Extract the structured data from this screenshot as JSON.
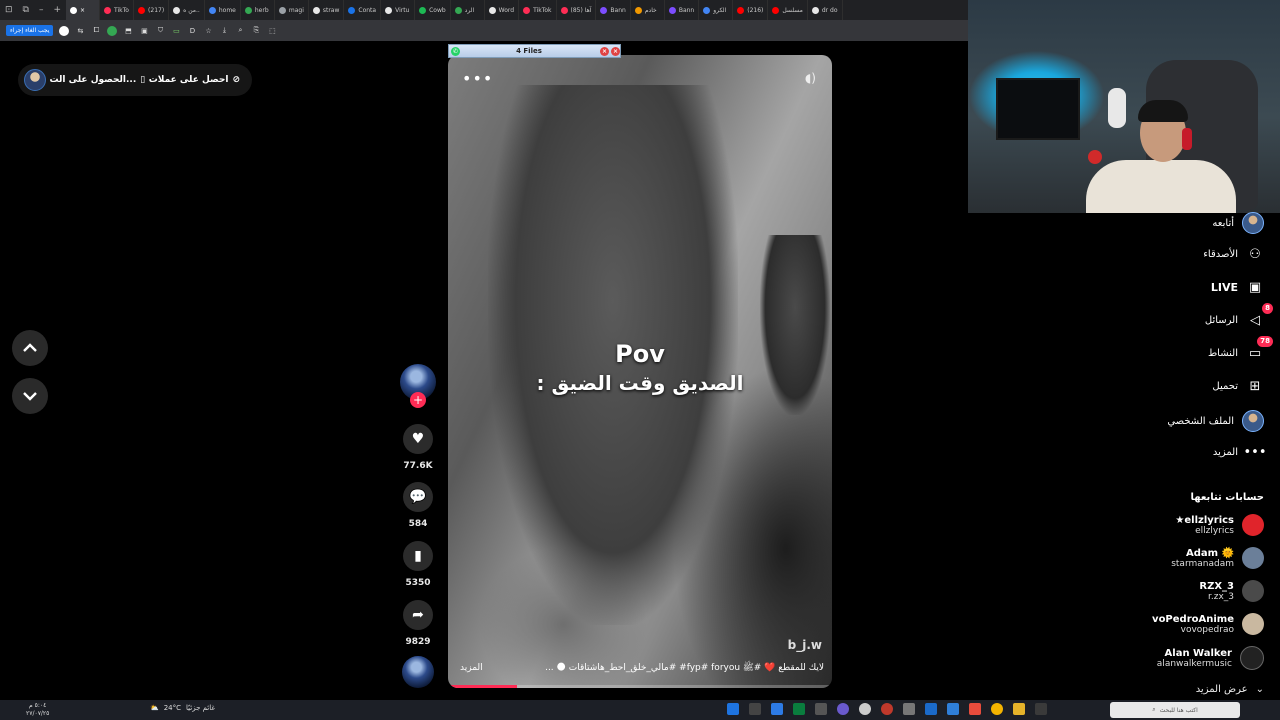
{
  "browser": {
    "tabs": [
      {
        "label": "TikTo",
        "color": "#ff2d55"
      },
      {
        "label": "(217)",
        "color": "#ff0000"
      },
      {
        "label": "من ه..",
        "color": "#e8e8e8"
      },
      {
        "label": "home",
        "color": "#4285f4"
      },
      {
        "label": "herb",
        "color": "#34a853"
      },
      {
        "label": "magi",
        "color": "#9aa0a6"
      },
      {
        "label": "straw",
        "color": "#e8e8e8"
      },
      {
        "label": "Conta",
        "color": "#1a73e8"
      },
      {
        "label": "Virtu",
        "color": "#e8e8e8"
      },
      {
        "label": "Cowb",
        "color": "#1db954"
      },
      {
        "label": "الرد",
        "color": "#34a853"
      },
      {
        "label": "Word",
        "color": "#e8e8e8"
      },
      {
        "label": "TikTok",
        "color": "#ff2d55"
      },
      {
        "label": "(85) آها",
        "color": "#ff2d55"
      },
      {
        "label": "Bann",
        "color": "#7c4dff"
      },
      {
        "label": "خادم",
        "color": "#f29900"
      },
      {
        "label": "Bann",
        "color": "#7c4dff"
      },
      {
        "label": "الكرو",
        "color": "#4285f4"
      },
      {
        "label": "(216)",
        "color": "#ff0000"
      },
      {
        "label": "مسلسل",
        "color": "#ff0000"
      },
      {
        "label": "dr do",
        "color": "#e8e8e8"
      }
    ],
    "cancel_label": "يجب الغاء إجراء"
  },
  "top_pills": {
    "coins_label": "احصل على عملات",
    "get_app_label": "الحصول على الت..."
  },
  "files_popup": {
    "title": "4 Files"
  },
  "video": {
    "caption_title": "Pov",
    "caption_sub": "الصديق وقت الضيق :",
    "watermark": "b_j.w",
    "description": "لايك للمقطع ❤️ #ﷺ fyp# foryou# #مالي_خلق_احط_هاشتاقات 🌑 ...",
    "more_label": "المزيد",
    "progress": 0.18
  },
  "actions": {
    "likes": "77.6K",
    "comments": "584",
    "saves": "5350",
    "shares": "9829"
  },
  "sidebar": {
    "items": [
      {
        "label": "أتابعه",
        "icon": "avatar-icon"
      },
      {
        "label": "الأصدقاء",
        "icon": "friends-icon"
      },
      {
        "label": "LIVE",
        "icon": "live-icon"
      },
      {
        "label": "الرسائل",
        "icon": "messages-icon",
        "badge": "8"
      },
      {
        "label": "النشاط",
        "icon": "activity-icon",
        "badge": "78"
      },
      {
        "label": "تحميل",
        "icon": "upload-icon"
      },
      {
        "label": "الملف الشخصي",
        "icon": "profile-icon"
      },
      {
        "label": "المزيد",
        "icon": "more-icon"
      }
    ],
    "following_title": "حسابات تتابعها",
    "accounts": [
      {
        "name": "★ellzlyrics",
        "handle": "ellzlyrics",
        "color": "#e0242b"
      },
      {
        "name": "Adam 🌞",
        "handle": "starmanadam",
        "color": "#6b7f99"
      },
      {
        "name": "RZX_3",
        "handle": "r.zx_3",
        "color": "#4a4a4a"
      },
      {
        "name": "voPedroAnime",
        "handle": "vovopedrao",
        "color": "#c9b8a0"
      },
      {
        "name": "Alan Walker",
        "handle": "alanwalkermusic",
        "color": "#222222"
      }
    ],
    "see_more": "عرض المزيد"
  },
  "taskbar": {
    "weather": "24°C",
    "weather_label": "غائم جزئيًا",
    "search_placeholder": "اكتب هنا للبحث",
    "time": "٥:٠٤ م",
    "date": "٢٧/٠٧/٢٥"
  }
}
